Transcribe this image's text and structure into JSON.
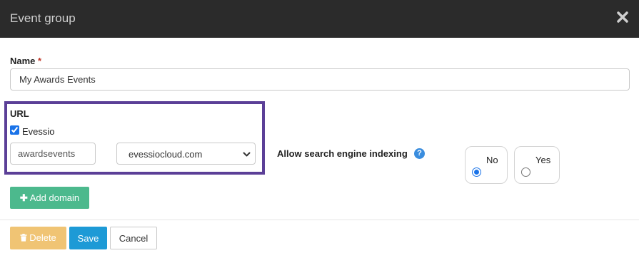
{
  "dialog": {
    "title": "Event group",
    "close_icon": "close-icon"
  },
  "name_field": {
    "label": "Name",
    "required_marker": "*",
    "value": "My Awards Events"
  },
  "url_section": {
    "label": "URL",
    "evessio_checkbox_label": "Evessio",
    "evessio_checked": true,
    "subdomain_value": "awardsevents",
    "domain_selected": "evessiocloud.com",
    "highlight_color": "#5b3f97"
  },
  "indexing": {
    "label": "Allow search engine indexing",
    "help_icon": "question-circle-icon",
    "options": [
      {
        "label": "No",
        "selected": true
      },
      {
        "label": "Yes",
        "selected": false
      }
    ]
  },
  "add_domain": {
    "icon": "plus-icon",
    "label": "Add domain"
  },
  "footer": {
    "delete_icon": "trash-icon",
    "delete_label": "Delete",
    "save_label": "Save",
    "cancel_label": "Cancel"
  },
  "colors": {
    "header_bg": "#2b2b2b",
    "add_domain_bg": "#4cb98d",
    "delete_bg": "#f0c474",
    "save_bg": "#1d9ad6",
    "radio_accent": "#1a73e8"
  }
}
